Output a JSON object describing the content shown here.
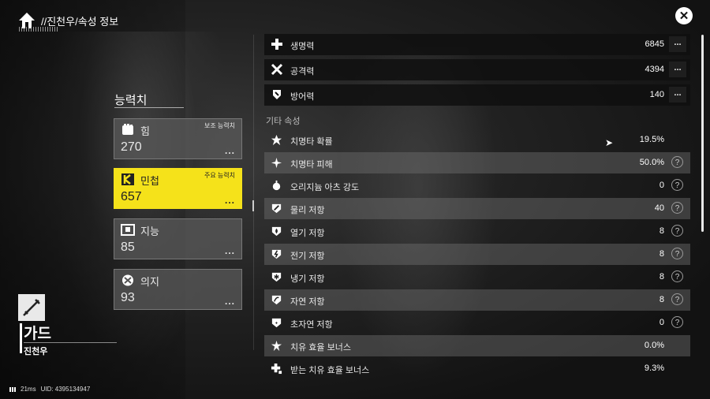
{
  "header": {
    "title": "//진천우/속성 정보",
    "logo_icon": "agent-logo-icon",
    "close_icon": "close-icon"
  },
  "stats": {
    "heading": "능력치",
    "cards": [
      {
        "icon": "fist-icon",
        "label": "힘",
        "value": "270",
        "tag": "보조 능력치",
        "active": false
      },
      {
        "icon": "dash-icon",
        "label": "민첩",
        "value": "657",
        "tag": "주요 능력치",
        "active": true
      },
      {
        "icon": "book-icon",
        "label": "지능",
        "value": "85",
        "tag": "",
        "active": false
      },
      {
        "icon": "will-icon",
        "label": "의지",
        "value": "93",
        "tag": "",
        "active": false
      }
    ],
    "more": "..."
  },
  "character": {
    "role": "가드",
    "name": "진천우",
    "role_icon": "sword-icon"
  },
  "footer": {
    "ping": "21ms",
    "uid": "UID: 4395134947"
  },
  "main_attributes": [
    {
      "icon": "health-icon",
      "label": "생명력",
      "value": "6845"
    },
    {
      "icon": "attack-icon",
      "label": "공격력",
      "value": "4394"
    },
    {
      "icon": "defense-icon",
      "label": "방어력",
      "value": "140"
    }
  ],
  "other_heading": "기타 속성",
  "other_attributes": [
    {
      "icon": "crit-rate-icon",
      "label": "치명타 확률",
      "value": "19.5%",
      "help": false
    },
    {
      "icon": "crit-damage-icon",
      "label": "치명타 피해",
      "value": "50.0%",
      "help": true
    },
    {
      "icon": "originium-icon",
      "label": "오리지늄 아츠 강도",
      "value": "0",
      "help": true
    },
    {
      "icon": "physical-res-icon",
      "label": "물리 저항",
      "value": "40",
      "help": true
    },
    {
      "icon": "heat-res-icon",
      "label": "열기 저항",
      "value": "8",
      "help": true
    },
    {
      "icon": "electric-res-icon",
      "label": "전기 저항",
      "value": "8",
      "help": true
    },
    {
      "icon": "cryo-res-icon",
      "label": "냉기 저항",
      "value": "8",
      "help": true
    },
    {
      "icon": "nature-res-icon",
      "label": "자연 저항",
      "value": "8",
      "help": true
    },
    {
      "icon": "aether-res-icon",
      "label": "초자연 저항",
      "value": "0",
      "help": true
    },
    {
      "icon": "heal-bonus-icon",
      "label": "치유 효율 보너스",
      "value": "0.0%",
      "help": false
    },
    {
      "icon": "heal-received-icon",
      "label": "받는 치유 효율 보너스",
      "value": "9.3%",
      "help": false
    }
  ],
  "help_glyph": "?",
  "colors": {
    "accent": "#f5e21a"
  }
}
